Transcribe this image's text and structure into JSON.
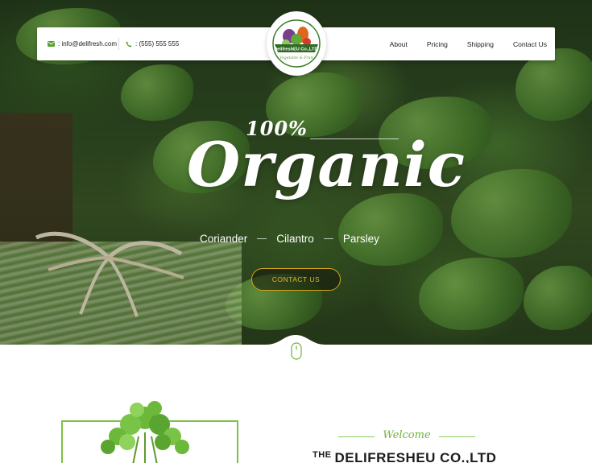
{
  "header": {
    "email": "info@delifresh.com",
    "phone": "(555) 555 555",
    "logo": {
      "name": "DelifreshEU Co.,LTD",
      "tagline": "Vegetable & Fruit"
    },
    "nav": [
      "About",
      "Pricing",
      "Shipping",
      "Contact Us"
    ]
  },
  "hero": {
    "percent": "100%",
    "headline": "Organic",
    "herbs": [
      "Coriander",
      "Cilantro",
      "Parsley"
    ],
    "cta_label": "CONTACT US"
  },
  "about": {
    "welcome": "Welcome",
    "the": "THE",
    "company": "DELIFRESHEU CO.,LTD"
  },
  "colors": {
    "accent_green": "#6fb43a",
    "cta_gold": "#d6a51c",
    "frame_green": "#7cc142"
  },
  "icons": {
    "email": "envelope-icon",
    "phone": "phone-icon",
    "scroll": "mouse-icon"
  }
}
